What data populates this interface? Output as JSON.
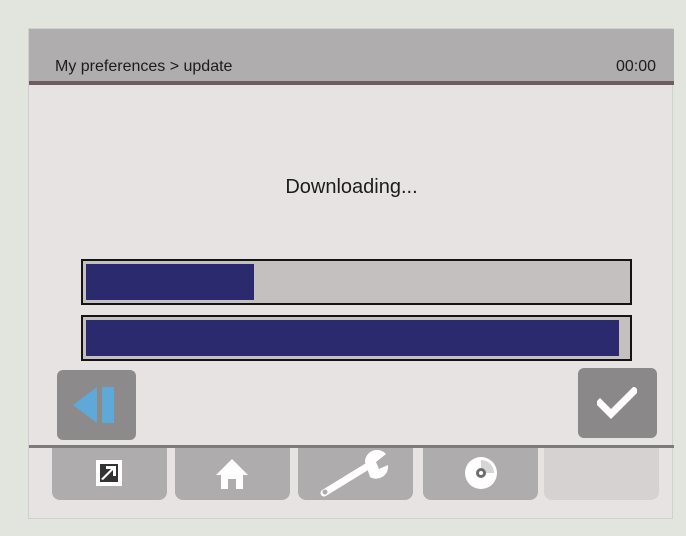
{
  "header": {
    "breadcrumb": "My preferences > update",
    "clock": "00:00"
  },
  "status_text": "Downloading...",
  "progress": {
    "file_download_fraction": 0.31,
    "total_fraction": 0.985,
    "fill_color": "#2c2a6e",
    "track_color": "#c4c0bf"
  },
  "buttons": {
    "back_icon": "back-icon",
    "confirm_icon": "check-icon"
  },
  "tabs": [
    {
      "icon": "external-link-icon"
    },
    {
      "icon": "home-icon"
    },
    {
      "icon": "wrench-icon"
    },
    {
      "icon": "disc-icon"
    },
    {
      "icon": ""
    }
  ],
  "colors": {
    "header_bg": "#afadad",
    "header_rule": "#6e5c60",
    "accent_blue": "#5fa9d8"
  }
}
